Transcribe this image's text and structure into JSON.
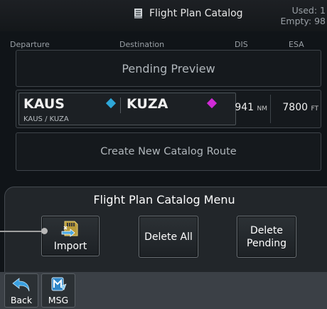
{
  "title_bar": {
    "icon": "catalog-book-icon",
    "title": "Flight Plan Catalog",
    "used": "Used: 1",
    "empty": "Empty: 98"
  },
  "columns": {
    "departure": "Departure",
    "destination": "Destination",
    "dis": "DIS",
    "esa": "ESA"
  },
  "pending_preview": "Pending Preview",
  "route": {
    "departure": "KAUS",
    "destination": "KUZA",
    "subtitle": "KAUS / KUZA",
    "distance": "941",
    "distance_unit": "NM",
    "esa": "7800",
    "esa_unit": "FT"
  },
  "create_route": "Create New Catalog Route",
  "menu": {
    "title": "Flight Plan Catalog Menu",
    "import_label": "Import",
    "delete_all_label": "Delete All",
    "delete_pending_line1": "Delete",
    "delete_pending_line2": "Pending"
  },
  "bottom_bar": {
    "back_label": "Back",
    "msg_label": "MSG"
  },
  "colors": {
    "background": "#101418",
    "waypoint_cyan": "#2ea7d8",
    "waypoint_magenta": "#d02ad6",
    "bottom_bar": "#3b4046"
  }
}
